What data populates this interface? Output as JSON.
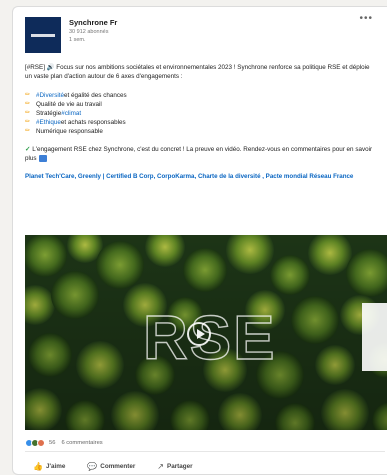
{
  "post": {
    "author": {
      "name": "Synchrone Fr",
      "followers": "30 912 abonnés",
      "time": "1 sem."
    },
    "intro": "[#RSE] 🔊 Focus sur nos ambitions sociétales et environnementales 2023 ! Synchrone renforce sa politique RSE et déploie un vaste plan d'action autour de 6 axes d'engagements :",
    "bullets": [
      {
        "hashtag": "#Diversité",
        "text": " et égalité des chances"
      },
      {
        "hashtag": "",
        "text": "Qualité de vie au travail"
      },
      {
        "hashtag": "#climat",
        "prefix": "Stratégie ",
        "text": ""
      },
      {
        "hashtag": "#Ethique",
        "text": " et achats responsables"
      },
      {
        "hashtag": "",
        "text": "Numérique responsable"
      }
    ],
    "outro": "L'engagement RSE chez Synchrone, c'est du concret ! La preuve en vidéo. Rendez-vous en commentaires pour en savoir plus",
    "partners": "Planet Tech'Care, Greenly | Certified B Corp, CorpoKarma, Charte de la diversité , Pacte mondial Réseau France",
    "media": {
      "overlay_text": "RSE"
    },
    "reactions": {
      "count": "56",
      "comments": "6 commentaires",
      "colors": [
        "#378fe9",
        "#44712e",
        "#df704d"
      ]
    },
    "actions": {
      "like": "J'aime",
      "comment": "Commenter",
      "share": "Partager"
    }
  }
}
